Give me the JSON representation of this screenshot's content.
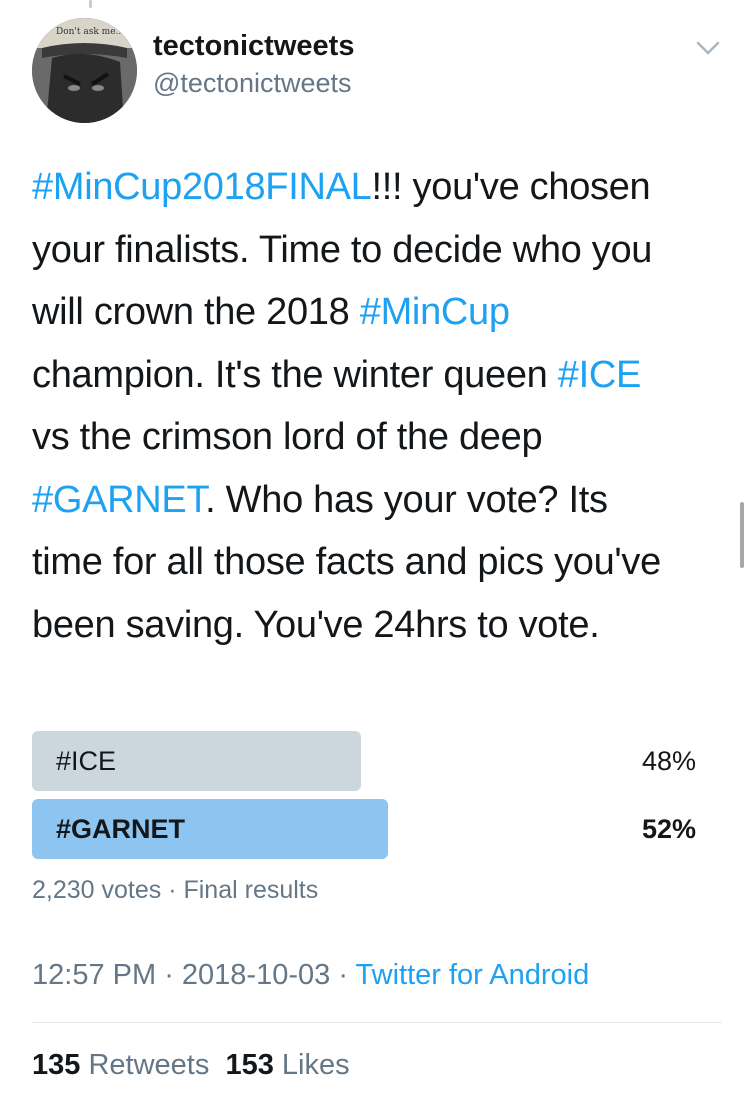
{
  "author": {
    "display_name": "tectonictweets",
    "handle": "@tectonictweets",
    "avatar_caption": "Don't ask me..."
  },
  "tweet": {
    "lines": [
      [
        {
          "t": "#MinCup2018FINAL",
          "tag": true
        },
        {
          "t": "!!! you've chosen"
        }
      ],
      [
        {
          "t": "your finalists. Time to decide who you"
        }
      ],
      [
        {
          "t": "will crown the 2018 "
        },
        {
          "t": "#MinCup",
          "tag": true
        }
      ],
      [
        {
          "t": "champion. It's the winter queen "
        },
        {
          "t": "#ICE",
          "tag": true
        }
      ],
      [
        {
          "t": "vs the crimson lord of the deep"
        }
      ],
      [
        {
          "t": "#GARNET",
          "tag": true
        },
        {
          "t": ". Who has your vote? Its"
        }
      ],
      [
        {
          "t": "time for all those facts and pics you've"
        }
      ],
      [
        {
          "t": "been saving. You've 24hrs to vote."
        }
      ]
    ]
  },
  "poll": {
    "options": [
      {
        "label": "#ICE",
        "percent_text": "48%",
        "percent": 48,
        "winner": false
      },
      {
        "label": "#GARNET",
        "percent_text": "52%",
        "percent": 52,
        "winner": true
      }
    ],
    "votes_text": "2,230 votes",
    "separator": " · ",
    "status_text": "Final results"
  },
  "meta": {
    "time": "12:57 PM",
    "date": "2018-10-03",
    "separator": " · ",
    "source": "Twitter for Android"
  },
  "stats": {
    "retweets_count": "135",
    "retweets_label": "Retweets",
    "likes_count": "153",
    "likes_label": "Likes"
  },
  "colors": {
    "link": "#1da1f2",
    "muted": "#657786",
    "poll_winner": "#8ec5f0",
    "poll_loser": "#ccd6dd"
  },
  "icons": {
    "more": "chevron-down-icon"
  }
}
